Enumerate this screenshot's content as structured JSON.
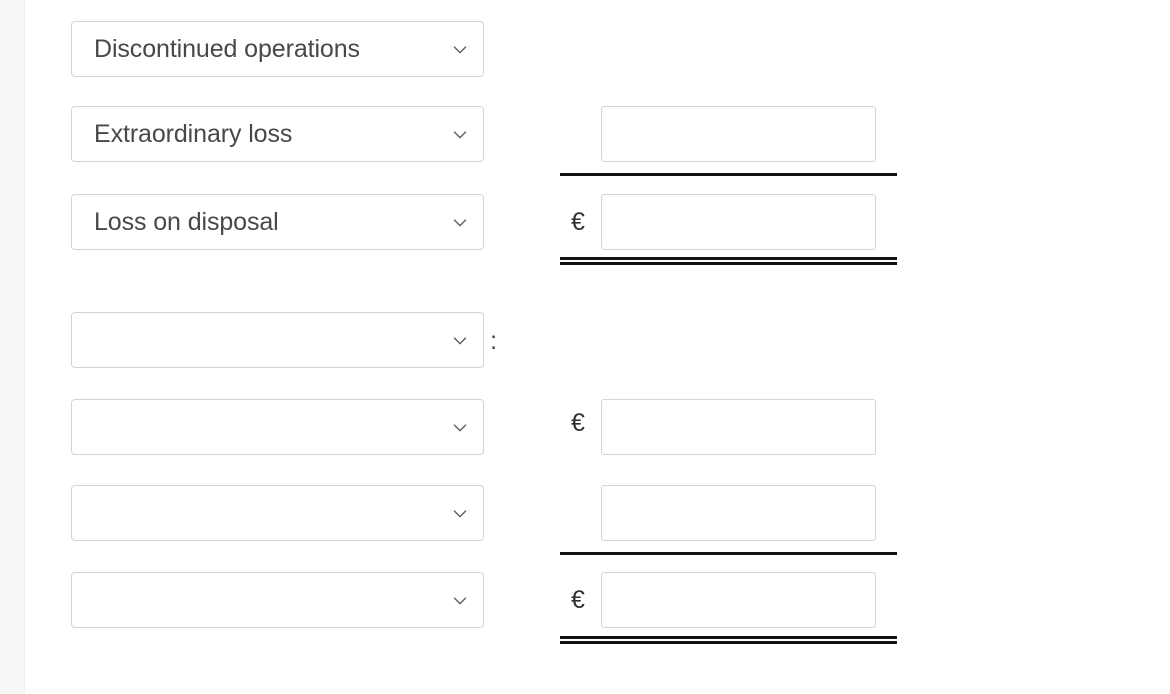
{
  "page": {
    "background_color": "#ffffff",
    "gutter_color": "#f7f7f8",
    "rule_color": "#111214",
    "field_border_color": "#d2d3d5",
    "text_color": "#47484a"
  },
  "currency_symbol": "€",
  "separator_symbol": ":",
  "chevron_icon": "chevron-down-icon",
  "rows": [
    {
      "id": "row-discontinued-operations",
      "select": {
        "value": "Discontinued operations",
        "placeholder": ""
      },
      "separator": "",
      "currency": "",
      "amount": {
        "value": "",
        "placeholder": ""
      },
      "rule": ""
    },
    {
      "id": "row-extraordinary-loss",
      "select": {
        "value": "Extraordinary loss",
        "placeholder": ""
      },
      "separator": "",
      "currency": "",
      "amount": {
        "value": "",
        "placeholder": ""
      },
      "rule": "single"
    },
    {
      "id": "row-loss-on-disposal",
      "select": {
        "value": "Loss on disposal",
        "placeholder": ""
      },
      "separator": "",
      "currency": "€",
      "amount": {
        "value": "",
        "placeholder": ""
      },
      "rule": "double"
    },
    {
      "id": "row-section-heading",
      "select": {
        "value": "",
        "placeholder": ""
      },
      "separator": ":",
      "currency": "",
      "amount": null,
      "rule": ""
    },
    {
      "id": "row-blank-1",
      "select": {
        "value": "",
        "placeholder": ""
      },
      "separator": "",
      "currency": "€",
      "amount": {
        "value": "",
        "placeholder": ""
      },
      "rule": ""
    },
    {
      "id": "row-blank-2",
      "select": {
        "value": "",
        "placeholder": ""
      },
      "separator": "",
      "currency": "",
      "amount": {
        "value": "",
        "placeholder": ""
      },
      "rule": "single"
    },
    {
      "id": "row-blank-3",
      "select": {
        "value": "",
        "placeholder": ""
      },
      "separator": "",
      "currency": "€",
      "amount": {
        "value": "",
        "placeholder": ""
      },
      "rule": "double"
    }
  ]
}
